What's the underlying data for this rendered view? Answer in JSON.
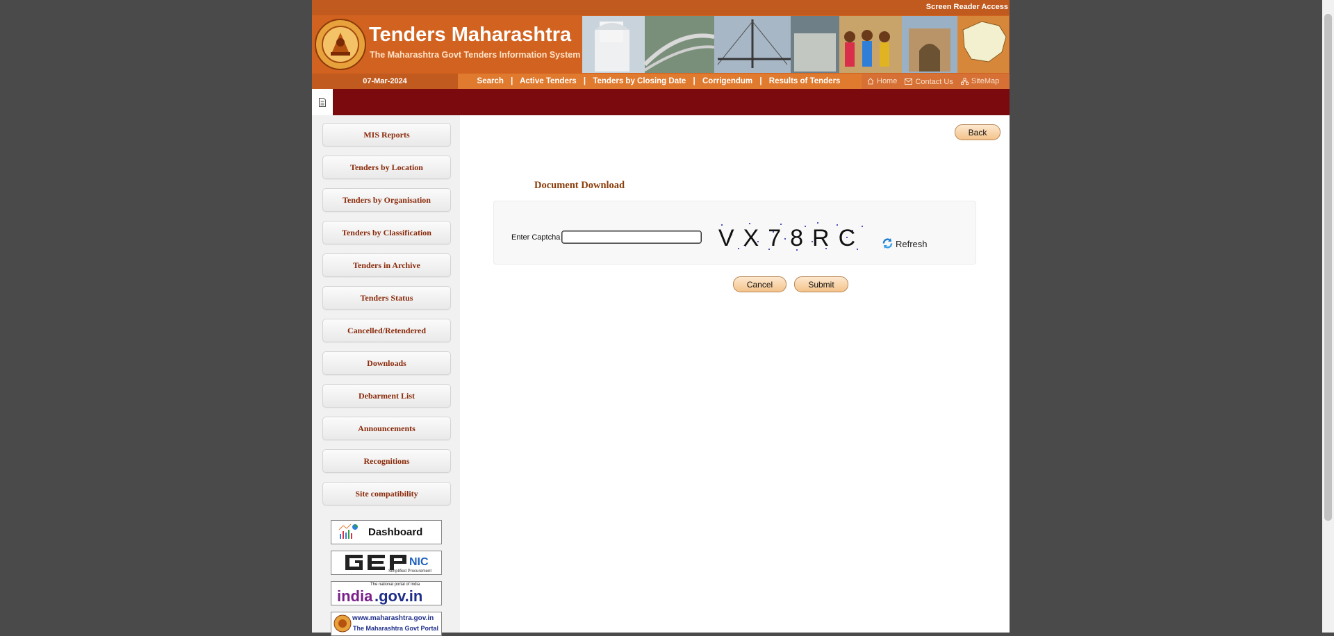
{
  "header": {
    "screen_reader": "Screen Reader Access",
    "title": "Tenders Maharashtra",
    "subtitle": "The Maharashtra Govt Tenders Information System"
  },
  "nav": {
    "date": "07-Mar-2024",
    "links": [
      "Search",
      "Active Tenders",
      "Tenders by Closing Date",
      "Corrigendum",
      "Results of Tenders"
    ],
    "separator": "|",
    "home": "Home",
    "contact": "Contact Us",
    "sitemap": "SiteMap"
  },
  "sidebar": {
    "items": [
      "MIS Reports",
      "Tenders by Location",
      "Tenders by Organisation",
      "Tenders by Classification",
      "Tenders in Archive",
      "Tenders Status",
      "Cancelled/Retendered",
      "Downloads",
      "Debarment List",
      "Announcements",
      "Recognitions",
      "Site compatibility"
    ],
    "logos": {
      "dashboard": "Dashboard",
      "gepnic_sub": "Simplified Procurement",
      "india_top": "The national portal of India",
      "maha_url": "www.maharashtra.gov.in",
      "maha_sub": "The Maharashtra Govt Portal"
    }
  },
  "main": {
    "back": "Back",
    "title": "Document Download",
    "captcha_label": "Enter Captcha",
    "captcha_value": "",
    "captcha_text": "VX78RC",
    "refresh": "Refresh",
    "cancel": "Cancel",
    "submit": "Submit"
  },
  "colors": {
    "brand_orange": "#d2621f",
    "nav_dark": "#c05a1e",
    "red_bar": "#7b0a0f",
    "link_brown": "#8a2a0a"
  }
}
